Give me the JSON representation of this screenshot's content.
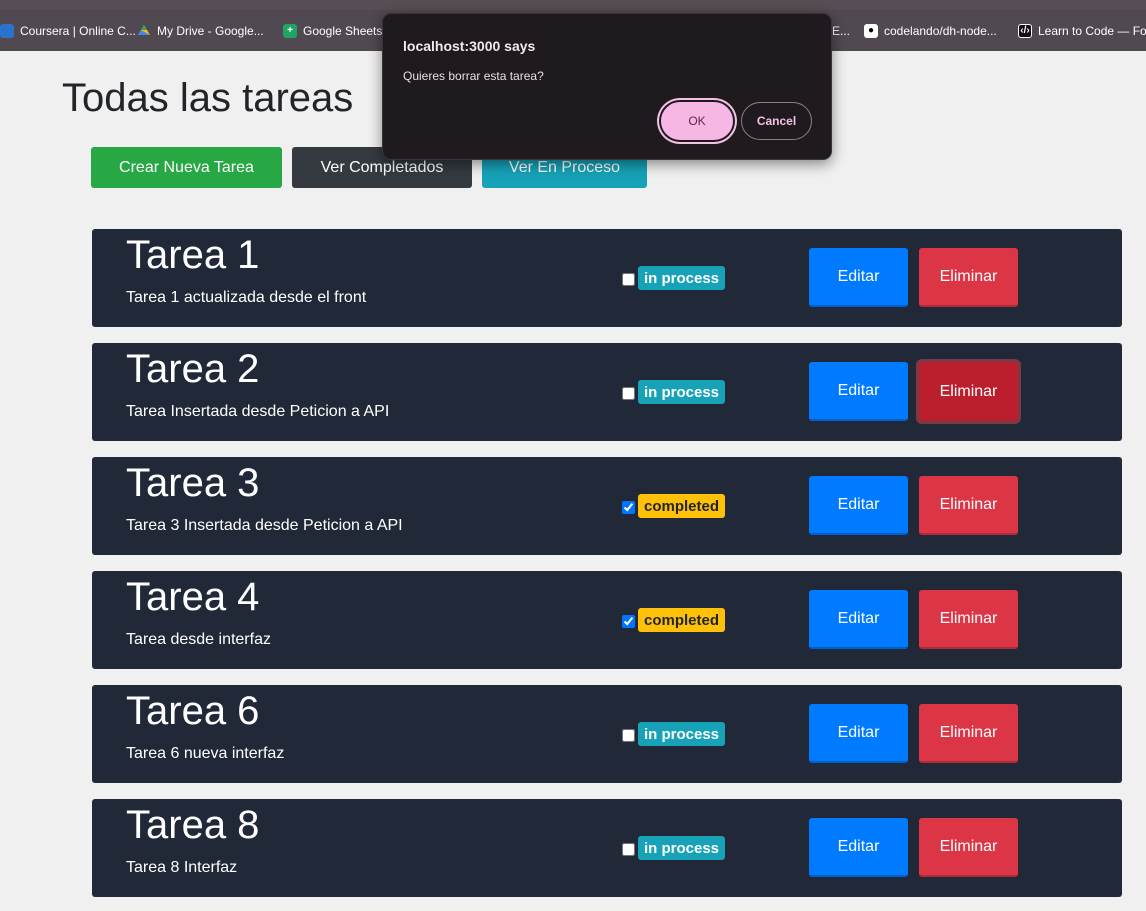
{
  "bookmarks": [
    {
      "label": "Coursera | Online C...",
      "icon": "coursera-icon"
    },
    {
      "label": "My Drive - Google...",
      "icon": "google-drive-icon"
    },
    {
      "label": "Google Sheets",
      "icon": "google-sheets-icon"
    },
    {
      "label": "E...",
      "icon": ""
    },
    {
      "label": "codelando/dh-node...",
      "icon": "github-icon"
    },
    {
      "label": "Learn to Code — Fo",
      "icon": "learn-to-code-icon"
    }
  ],
  "page": {
    "title": "Todas las tareas"
  },
  "nav": {
    "create_label": "Crear Nueva Tarea",
    "completed_label": "Ver Completados",
    "in_process_label": "Ver En Proceso"
  },
  "tasks": [
    {
      "title": "Tarea 1",
      "description": "Tarea 1 actualizada desde el front",
      "completed": false,
      "status": "in process",
      "edit_label": "Editar",
      "delete_label": "Eliminar"
    },
    {
      "title": "Tarea 2",
      "description": "Tarea Insertada desde Peticion a API",
      "completed": false,
      "status": "in process",
      "edit_label": "Editar",
      "delete_label": "Eliminar"
    },
    {
      "title": "Tarea 3",
      "description": "Tarea 3 Insertada desde Peticion a API",
      "completed": true,
      "status": "completed",
      "edit_label": "Editar",
      "delete_label": "Eliminar"
    },
    {
      "title": "Tarea 4",
      "description": "Tarea desde interfaz",
      "completed": true,
      "status": "completed",
      "edit_label": "Editar",
      "delete_label": "Eliminar"
    },
    {
      "title": "Tarea 6",
      "description": "Tarea 6 nueva interfaz",
      "completed": false,
      "status": "in process",
      "edit_label": "Editar",
      "delete_label": "Eliminar"
    },
    {
      "title": "Tarea 8",
      "description": "Tarea 8 Interfaz",
      "completed": false,
      "status": "in process",
      "edit_label": "Editar",
      "delete_label": "Eliminar"
    }
  ],
  "dialog": {
    "origin": "localhost:3000 says",
    "message": "Quieres borrar esta tarea?",
    "ok_label": "OK",
    "cancel_label": "Cancel"
  },
  "colors": {
    "success": "#28a745",
    "dark": "#343a40",
    "info": "#17a2b8",
    "warning": "#ffc107",
    "primary": "#007bff",
    "danger": "#dc3545",
    "card_bg": "#212938"
  }
}
